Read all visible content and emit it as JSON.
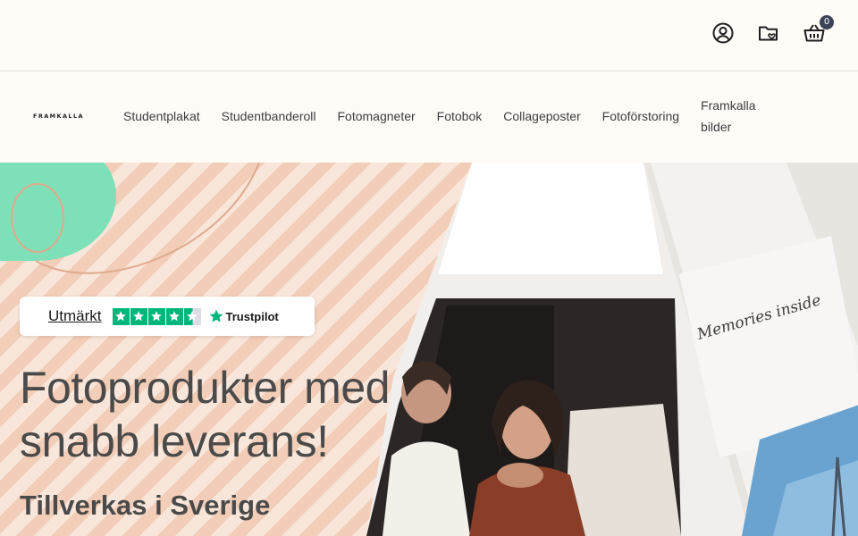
{
  "header": {
    "icons": [
      {
        "name": "account-icon"
      },
      {
        "name": "favorites-folder-icon"
      },
      {
        "name": "cart-icon"
      }
    ],
    "cart_count": "0"
  },
  "nav": {
    "logo": "FRAMKALLA",
    "items": [
      {
        "label": "Studentplakat"
      },
      {
        "label": "Studentbanderoll"
      },
      {
        "label": "Fotomagneter"
      },
      {
        "label": "Fotobok"
      },
      {
        "label": "Collageposter"
      },
      {
        "label": "Fotoförstoring"
      },
      {
        "label": "Framkalla bilder"
      }
    ]
  },
  "hero": {
    "trustpilot": {
      "rating_word": "Utmärkt",
      "brand": "Trustpilot",
      "stars": 4.5
    },
    "headline": "Fotoprodukter med snabb leverans!",
    "subheadline": "Tillverkas i Sverige",
    "photo_caption": "Memories inside"
  },
  "colors": {
    "stripe_light": "#f9e6da",
    "stripe_dark": "#f2cdb7",
    "mint": "#7ee0b8",
    "trustpilot_green": "#00b67a",
    "text": "#4a4a4a"
  }
}
